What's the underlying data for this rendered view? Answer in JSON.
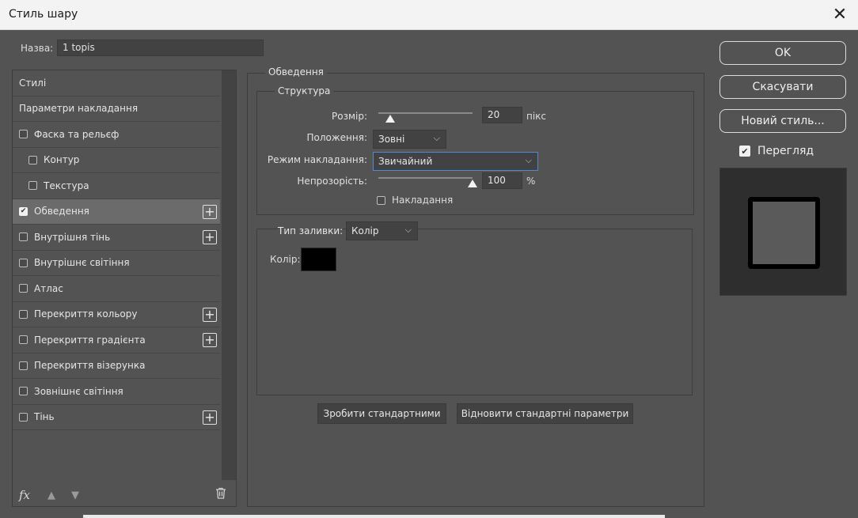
{
  "window": {
    "title": "Стиль шару",
    "close_glyph": "✕"
  },
  "name_field": {
    "label": "Назва:",
    "value": "1 topis"
  },
  "styles_list": [
    {
      "label": "Стилі",
      "has_checkbox": false,
      "checked": false,
      "sub": false,
      "plus": false
    },
    {
      "label": "Параметри накладання",
      "has_checkbox": false,
      "checked": false,
      "sub": false,
      "plus": false
    },
    {
      "label": "Фаска та рельєф",
      "has_checkbox": true,
      "checked": false,
      "sub": false,
      "plus": false
    },
    {
      "label": "Контур",
      "has_checkbox": true,
      "checked": false,
      "sub": true,
      "plus": false
    },
    {
      "label": "Текстура",
      "has_checkbox": true,
      "checked": false,
      "sub": true,
      "plus": false
    },
    {
      "label": "Обведення",
      "has_checkbox": true,
      "checked": true,
      "sub": false,
      "plus": true,
      "active": true
    },
    {
      "label": "Внутрішня тінь",
      "has_checkbox": true,
      "checked": false,
      "sub": false,
      "plus": true
    },
    {
      "label": "Внутрішнє світіння",
      "has_checkbox": true,
      "checked": false,
      "sub": false,
      "plus": false
    },
    {
      "label": "Атлас",
      "has_checkbox": true,
      "checked": false,
      "sub": false,
      "plus": false
    },
    {
      "label": "Перекриття кольору",
      "has_checkbox": true,
      "checked": false,
      "sub": false,
      "plus": true
    },
    {
      "label": "Перекриття градієнта",
      "has_checkbox": true,
      "checked": false,
      "sub": false,
      "plus": true
    },
    {
      "label": "Перекриття візерунка",
      "has_checkbox": true,
      "checked": false,
      "sub": false,
      "plus": false
    },
    {
      "label": "Зовнішнє світіння",
      "has_checkbox": true,
      "checked": false,
      "sub": false,
      "plus": false
    },
    {
      "label": "Тінь",
      "has_checkbox": true,
      "checked": false,
      "sub": false,
      "plus": true
    }
  ],
  "list_footer": {
    "fx": "fx",
    "up_icon": "arrow-up-icon",
    "down_icon": "arrow-down-icon",
    "trash_icon": "trash-icon"
  },
  "stroke": {
    "group_title": "Обведення",
    "structure_title": "Структура",
    "size": {
      "label": "Розмір:",
      "value": "20",
      "unit": "пікс",
      "slider_fraction": 0.13
    },
    "position": {
      "label": "Положення:",
      "value": "Зовні"
    },
    "blend_mode": {
      "label": "Режим накладання:",
      "value": "Звичайний"
    },
    "opacity": {
      "label": "Непрозорість:",
      "value": "100",
      "unit": "%",
      "slider_fraction": 1.0
    },
    "overprint": {
      "label": "Накладання",
      "checked": false
    },
    "fill_type": {
      "label": "Тип заливки:",
      "value": "Колір"
    },
    "color": {
      "label": "Колір:",
      "value": "#000000"
    },
    "make_default": "Зробити стандартними",
    "reset_default": "Відновити стандартні параметри"
  },
  "actions": {
    "ok": "OK",
    "cancel": "Скасувати",
    "new_style": "Новий стиль...",
    "preview": {
      "label": "Перегляд",
      "checked": true
    }
  },
  "colors": {
    "accent_focus": "#4a8ad6",
    "panel_bg": "#535353",
    "input_bg": "#424242"
  }
}
